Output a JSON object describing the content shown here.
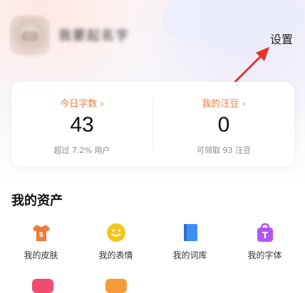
{
  "profile": {
    "username": "我要起名字",
    "settings_label": "设置"
  },
  "stats": [
    {
      "label": "今日字数 ›",
      "value": "43",
      "sub": "超过 7.2% 用户"
    },
    {
      "label": "我的汪豆 ›",
      "value": "0",
      "sub": "可领取 93 汪豆"
    }
  ],
  "assets": {
    "title": "我的资产",
    "items": [
      {
        "label": "我的皮肤",
        "icon": "tshirt-icon",
        "color": "#f07a3c"
      },
      {
        "label": "我的表情",
        "icon": "smiley-icon",
        "color": "#f5c51c"
      },
      {
        "label": "我的词库",
        "icon": "book-icon",
        "color": "#3d8ef5"
      },
      {
        "label": "我的字体",
        "icon": "shopping-bag-icon",
        "color": "#b155f0"
      }
    ]
  },
  "colors": {
    "accent_orange": "#f07a3c",
    "arrow_red": "#e8302a"
  }
}
